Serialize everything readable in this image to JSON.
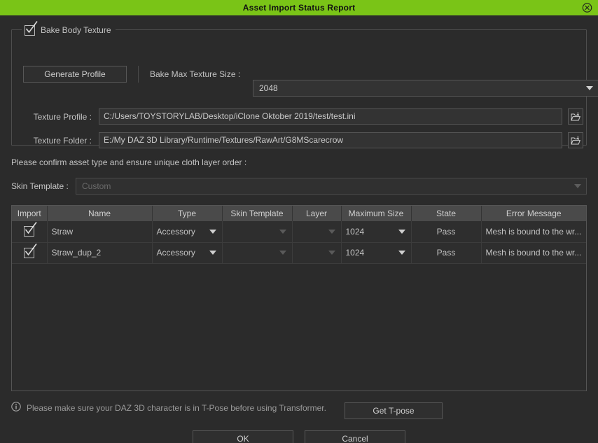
{
  "window": {
    "title": "Asset Import Status Report",
    "close_icon": "circle-x-icon",
    "titlebar_color": "#7ac417"
  },
  "bake_group": {
    "checkbox_label": "Bake Body Texture",
    "checked": true,
    "generate_profile_label": "Generate Profile",
    "bake_max_texture_size_label": "Bake Max Texture Size :",
    "bake_max_texture_size_value": "2048",
    "texture_profile_label": "Texture Profile :",
    "texture_profile_value": "C:/Users/TOYSTORYLAB/Desktop/iClone Oktober 2019/test/test.ini",
    "texture_folder_label": "Texture Folder :",
    "texture_folder_value": "E:/My DAZ 3D Library/Runtime/Textures/RawArt/G8MScarecrow",
    "browse_icon": "folder-open-import-icon"
  },
  "confirm": {
    "text": "Please confirm asset type and ensure unique cloth layer order :",
    "skin_template_label": "Skin Template :",
    "skin_template_value": "Custom",
    "skin_template_disabled": true
  },
  "table": {
    "headers": [
      "Import",
      "Name",
      "Type",
      "Skin Template",
      "Layer",
      "Maximum Size",
      "State",
      "Error Message"
    ],
    "rows": [
      {
        "import_checked": true,
        "name": "Straw",
        "type": "Accessory",
        "skin_template": "",
        "layer": "",
        "maximum_size": "1024",
        "state": "Pass",
        "error_message": "Mesh is bound to the wr..."
      },
      {
        "import_checked": true,
        "name": "Straw_dup_2",
        "type": "Accessory",
        "skin_template": "",
        "layer": "",
        "maximum_size": "1024",
        "state": "Pass",
        "error_message": "Mesh is bound to the wr..."
      }
    ],
    "state_pass_color": "#2fae2f"
  },
  "footer": {
    "info_icon": "info-circle-icon",
    "note": "Please make sure your DAZ 3D character is in T-Pose before using Transformer.",
    "get_tpose_label": "Get T-pose",
    "ok_label": "OK",
    "cancel_label": "Cancel"
  }
}
